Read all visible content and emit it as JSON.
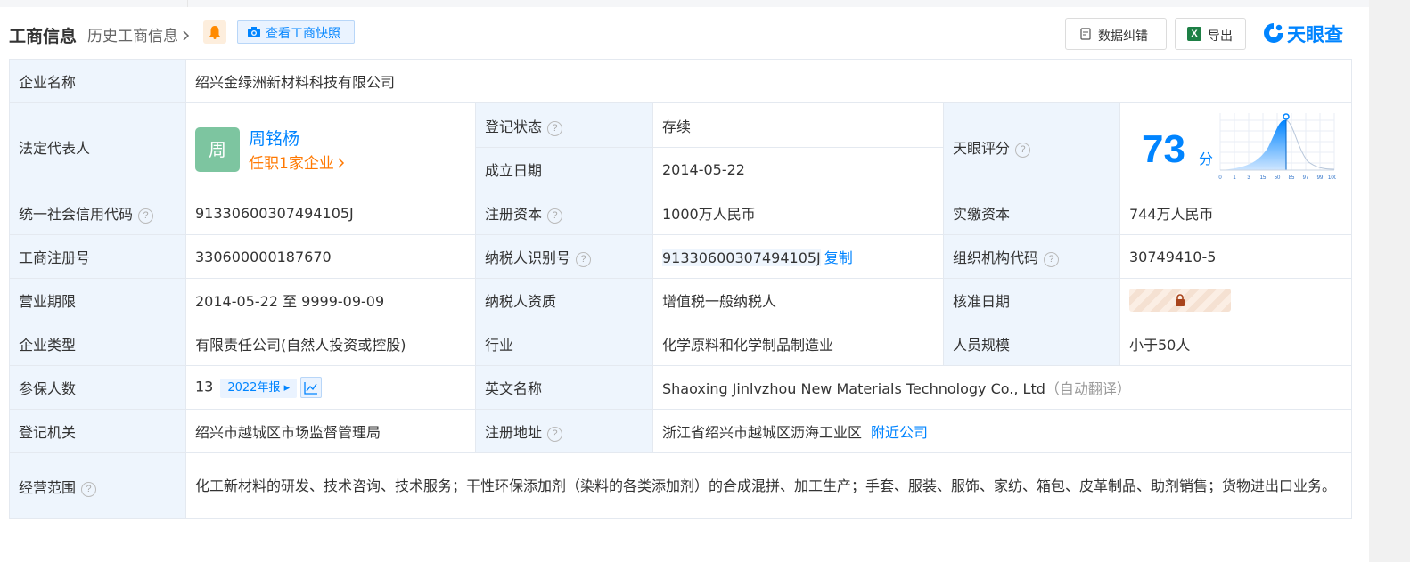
{
  "header": {
    "title": "工商信息",
    "history_link": "历史工商信息",
    "snapshot_button": "查看工商快照",
    "data_fix_button": "数据纠错",
    "export_button": "导出",
    "excel_icon_text": "X",
    "brand": "天眼查"
  },
  "company": {
    "name_label": "企业名称",
    "name": "绍兴金绿洲新材料科技有限公司",
    "legal_rep_label": "法定代表人",
    "legal_rep_avatar": "周",
    "legal_rep_name": "周铭杨",
    "legal_rep_jobs": "任职1家企业",
    "status_label": "登记状态",
    "status": "存续",
    "founded_label": "成立日期",
    "founded": "2014-05-22",
    "score_label": "天眼评分",
    "score": "73",
    "score_unit": "分",
    "score_axis": [
      "0",
      "1",
      "3",
      "15",
      "50",
      "85",
      "97",
      "99",
      "100"
    ],
    "credit_code_label": "统一社会信用代码",
    "credit_code": "91330600307494105J",
    "reg_capital_label": "注册资本",
    "reg_capital": "1000万人民币",
    "paid_capital_label": "实缴资本",
    "paid_capital": "744万人民币",
    "reg_no_label": "工商注册号",
    "reg_no": "330600000187670",
    "tax_id_label": "纳税人识别号",
    "tax_id": "91330600307494105J",
    "copy_label": "复制",
    "org_code_label": "组织机构代码",
    "org_code": "30749410-5",
    "term_label": "营业期限",
    "term": "2014-05-22 至 9999-09-09",
    "taxpayer_label": "纳税人资质",
    "taxpayer": "增值税一般纳税人",
    "approve_label": "核准日期",
    "type_label": "企业类型",
    "type": "有限责任公司(自然人投资或控股)",
    "industry_label": "行业",
    "industry": "化学原料和化学制品制造业",
    "staff_label": "人员规模",
    "staff": "小于50人",
    "insured_label": "参保人数",
    "insured": "13",
    "insured_year": "2022年报",
    "english_label": "英文名称",
    "english": "Shaoxing Jinlvzhou New Materials Technology Co., Ltd",
    "auto_translate": "（自动翻译）",
    "authority_label": "登记机关",
    "authority": "绍兴市越城区市场监督管理局",
    "address_label": "注册地址",
    "address": "浙江省绍兴市越城区沥海工业区",
    "nearby": "附近公司",
    "scope_label": "经营范围",
    "scope": "化工新材料的研发、技术咨询、技术服务；干性环保添加剂（染料的各类添加剂）的合成混拼、加工生产；手套、服装、服饰、家纺、箱包、皮革制品、助剂销售；货物进出口业务。"
  },
  "colors": {
    "accent": "#0084ff",
    "label_bg": "#eef5fd",
    "status_green": "#0d9c4f",
    "orange": "#ff7800"
  },
  "icons": [
    "bell-icon",
    "camera-icon",
    "chevron-right-icon",
    "question-icon",
    "document-icon",
    "excel-icon",
    "lock-icon",
    "trend-icon",
    "tianyancha-logo-icon"
  ]
}
